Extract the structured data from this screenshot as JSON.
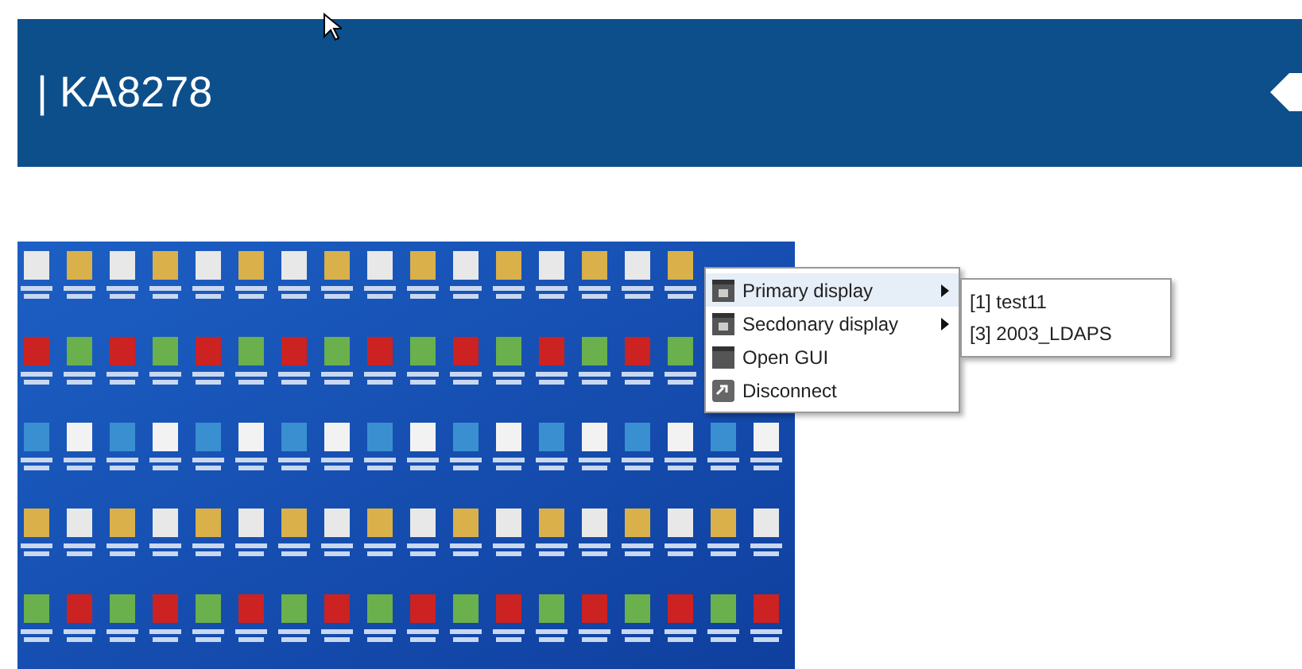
{
  "header": {
    "title": "| KA8278"
  },
  "context_menu": {
    "items": [
      {
        "label": "Primary display",
        "kind": "submenu",
        "selected": true
      },
      {
        "label": "Secdonary display",
        "kind": "submenu",
        "selected": false
      },
      {
        "label": "Open GUI",
        "kind": "action",
        "selected": false
      },
      {
        "label": "Disconnect",
        "kind": "action",
        "selected": false
      }
    ]
  },
  "submenu": {
    "items": [
      {
        "label": "[1] test11"
      },
      {
        "label": "[3] 2003_LDAPS"
      }
    ]
  }
}
